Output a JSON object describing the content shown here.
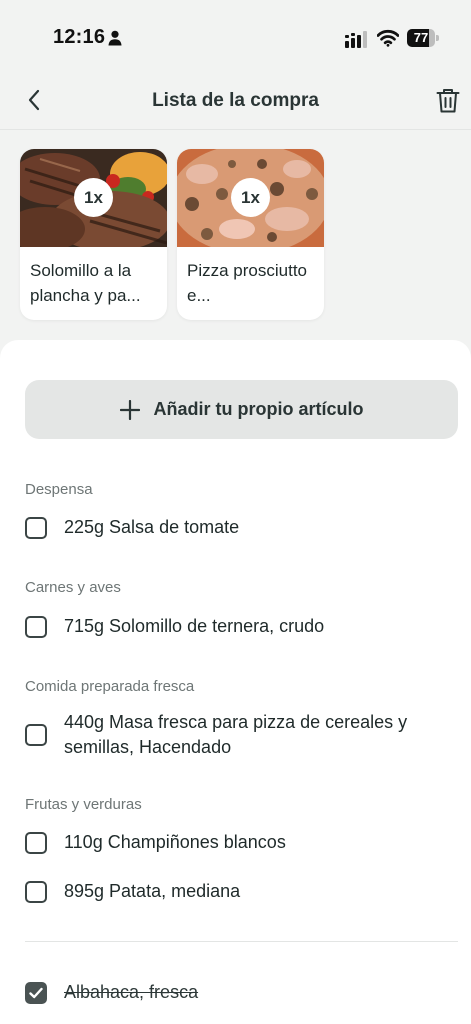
{
  "status_bar": {
    "time": "12:16",
    "battery_level": "77",
    "battery_fraction": 0.77
  },
  "header": {
    "title": "Lista de la compra",
    "icons": {
      "back": "chevron-left-icon",
      "delete": "trash-icon"
    }
  },
  "recipes": [
    {
      "name": "Solomillo a la plancha y pa...",
      "quantity": "1x",
      "image": "grilled-steak-photo"
    },
    {
      "name": "Pizza prosciutto e...",
      "quantity": "1x",
      "image": "pizza-photo"
    }
  ],
  "add_button": {
    "label": "Añadir tu propio artículo",
    "icon": "plus-icon"
  },
  "sections": [
    {
      "title": "Despensa",
      "items": [
        {
          "text": "225g Salsa de tomate",
          "checked": false
        }
      ]
    },
    {
      "title": "Carnes y aves",
      "items": [
        {
          "text": "715g Solomillo de ternera, crudo",
          "checked": false
        }
      ]
    },
    {
      "title": "Comida preparada fresca",
      "items": [
        {
          "text": "440g Masa fresca para pizza de cereales y semillas, Hacendado",
          "checked": false
        }
      ]
    },
    {
      "title": "Frutas y verduras",
      "items": [
        {
          "text": "110g Champiñones blancos",
          "checked": false
        },
        {
          "text": "895g Patata, mediana",
          "checked": false
        }
      ]
    }
  ],
  "checked_items": [
    {
      "text": "Albahaca, fresca",
      "checked": true
    }
  ],
  "colors": {
    "background": "#f2f3f2",
    "panel": "#ffffff",
    "text": "#1f2a2a",
    "muted": "#6e7676",
    "button": "#e4e6e5",
    "checked": "#4a5353"
  }
}
